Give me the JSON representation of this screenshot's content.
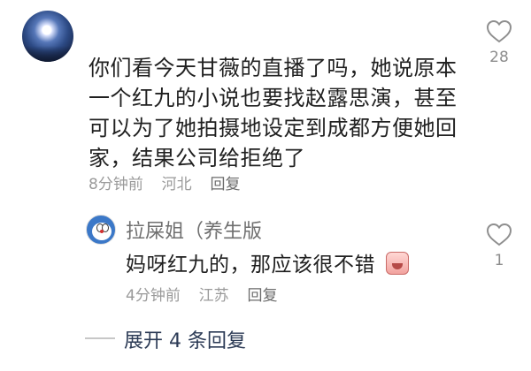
{
  "comment": {
    "text": "你们看今天甘薇的直播了吗，她说原本\n一个红九的小说也要找赵露思演，甚至\n可以为了她拍摄地设定到成都方便她回\n家，结果公司给拒绝了",
    "time": "8分钟前",
    "location": "河北",
    "reply_label": "回复",
    "like_count": "28"
  },
  "reply": {
    "username": "拉屎姐（养生版",
    "text": "妈呀红九的，那应该很不错",
    "time": "4分钟前",
    "location": "江苏",
    "reply_label": "回复",
    "like_count": "1"
  },
  "expand": {
    "label": "展开 4 条回复"
  },
  "icons": {
    "like": "heart-outline-icon",
    "emoji": "crying-face-emoji"
  },
  "colors": {
    "text_primary": "#202020",
    "text_secondary": "#9a9a9a",
    "expand_text": "#2b3a55"
  }
}
